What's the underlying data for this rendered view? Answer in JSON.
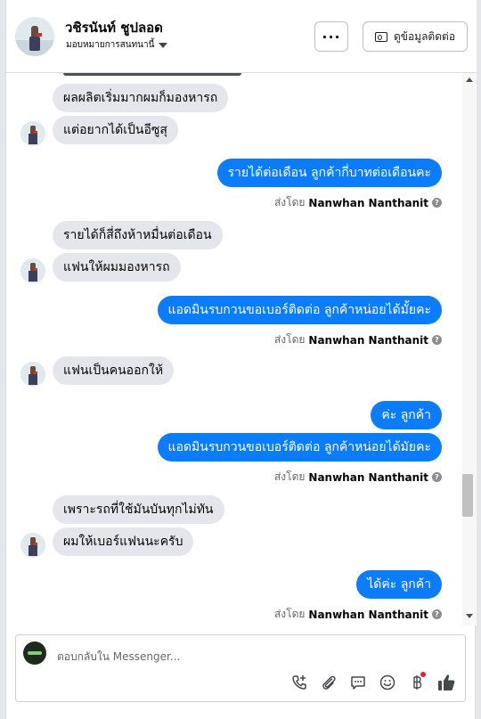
{
  "header": {
    "name": "วชิรนันท์ ชูปลอด",
    "subtitle": "มอบหมายการสนทนานี้",
    "more_label": "···",
    "contact_label": "ดูข้อมูลติดต่อ"
  },
  "thread": {
    "messages": [
      {
        "dir": "in",
        "text": "ผลผลิตเริ่มมากผมก็มองหารถ"
      },
      {
        "dir": "in",
        "text": "แต่อยากได้เป็นอีซูสุ"
      },
      {
        "dir": "out",
        "text": "รายได้ต่อเดือน ลูกค้ากี่บาทต่อเดือนคะ"
      },
      {
        "dir": "in",
        "text": "รายได้ก็สี่ถึงห้าหมื่นต่อเดือน"
      },
      {
        "dir": "in",
        "text": "แฟนให้ผมมองหารถ"
      },
      {
        "dir": "out",
        "text": "แอดมินรบกวนขอเบอร์ติดต่อ ลูกค้าหน่อยได้มั้ยคะ"
      },
      {
        "dir": "in",
        "text": "แฟนเป็นคนออกให้"
      },
      {
        "dir": "out",
        "text": "ค่ะ ลูกค้า"
      },
      {
        "dir": "out",
        "text": "แอดมินรบกวนขอเบอร์ติดต่อ ลูกค้าหน่อยได้มัยคะ"
      },
      {
        "dir": "in",
        "text": "เพราะรถที่ใช้มันบันทุกไม่ทัน"
      },
      {
        "dir": "in",
        "text": "ผมให้เบอร์แฟนนะครับ"
      },
      {
        "dir": "out",
        "text": "ได้ค่ะ ลูกค้า"
      }
    ],
    "sent_by_prefix": "ส่งโดย",
    "sent_by_name": "Nanwhan Nanthanit",
    "help_glyph": "?"
  },
  "composer": {
    "placeholder": "ตอบกลับใน Messenger..."
  },
  "icons": {
    "call": "phone-plus-icon",
    "attach": "paperclip-icon",
    "saved": "saved-reply-icon",
    "emoji": "emoji-icon",
    "payment": "baht-icon",
    "like": "thumbs-up-icon"
  },
  "colors": {
    "outgoing": "#0a7cff",
    "incoming": "#e4e6eb"
  }
}
